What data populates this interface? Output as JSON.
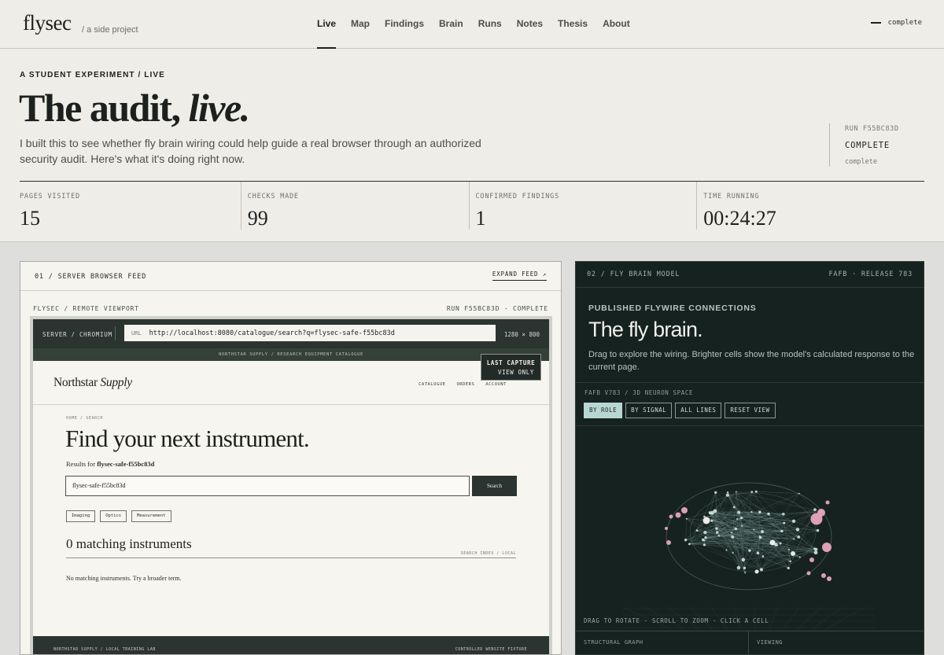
{
  "app": {
    "logo": "flysec",
    "tagline": "/ a side project",
    "status": "complete"
  },
  "nav": [
    {
      "label": "Live",
      "active": true
    },
    {
      "label": "Map"
    },
    {
      "label": "Findings"
    },
    {
      "label": "Brain"
    },
    {
      "label": "Runs"
    },
    {
      "label": "Notes"
    },
    {
      "label": "Thesis"
    },
    {
      "label": "About"
    }
  ],
  "hero": {
    "eyebrow": "A STUDENT EXPERIMENT / LIVE",
    "title_main": "The audit, ",
    "title_em": "live.",
    "description": "I built this to see whether fly brain wiring could help guide a real browser through an authorized security audit. Here's what it's doing right now."
  },
  "run": {
    "id_label": "RUN F55BC83D",
    "status": "COMPLETE",
    "substatus": "complete"
  },
  "stats": [
    {
      "label": "PAGES VISITED",
      "value": "15"
    },
    {
      "label": "CHECKS MADE",
      "value": "99"
    },
    {
      "label": "CONFIRMED FINDINGS",
      "value": "1"
    },
    {
      "label": "TIME RUNNING",
      "value": "00:24:27"
    }
  ],
  "feed": {
    "title": "01 / SERVER BROWSER FEED",
    "expand": "EXPAND FEED ↗",
    "viewport_label": "FLYSEC / REMOTE VIEWPORT",
    "run_label": "RUN F55BC83D · COMPLETE",
    "engine": "SERVER / CHROMIUM",
    "url_label": "URL",
    "url": "http://localhost:8080/catalogue/search?q=flysec-safe-f55bc83d",
    "size": "1280 × 800",
    "capture_line1": "LAST CAPTURE",
    "capture_line2": "VIEW ONLY"
  },
  "site": {
    "strip": "NORTHSTAR SUPPLY / RESEARCH EQUIPMENT CATALOGUE",
    "brand_main": "Northstar ",
    "brand_em": "Supply",
    "links": [
      "CATALOGUE",
      "ORDERS",
      "ACCOUNT"
    ],
    "crumb": "HOME / SEARCH",
    "heading": "Find your next instrument.",
    "results_prefix": "Results for ",
    "results_query": "flysec-safe-f55bc83d",
    "search_value": "flysec-safe-f55bc83d",
    "search_button": "Search",
    "chips": [
      "Imaging",
      "Optics",
      "Measurement"
    ],
    "match_heading": "0 matching instruments",
    "search_index": "SEARCH INDEX / LOCAL",
    "no_match": "No matching instruments. Try a broader term.",
    "footer_left": "NORTHSTAR SUPPLY / LOCAL TRAINING LAB",
    "footer_right": "CONTROLLED WEBSITE FIXTURE"
  },
  "brain": {
    "title": "02 / FLY BRAIN MODEL",
    "release": "FAFB · RELEASE 783",
    "eyebrow": "PUBLISHED FLYWIRE CONNECTIONS",
    "heading": "The fly brain.",
    "description": "Drag to explore the wiring. Brighter cells show the model's calculated response to the current page.",
    "space_label": "FAFB V783 / 3D NEURON SPACE",
    "buttons": [
      "BY ROLE",
      "BY SIGNAL",
      "ALL LINES",
      "RESET VIEW"
    ],
    "hint": "DRAG TO ROTATE · SCROLL TO ZOOM · CLICK A CELL",
    "foot_left": "STRUCTURAL GRAPH",
    "foot_right": "VIEWING",
    "colors": {
      "background": "#162220",
      "node": "#cfe3df",
      "highlight": "#e7a6bf",
      "line": "#8fb3ad"
    }
  }
}
